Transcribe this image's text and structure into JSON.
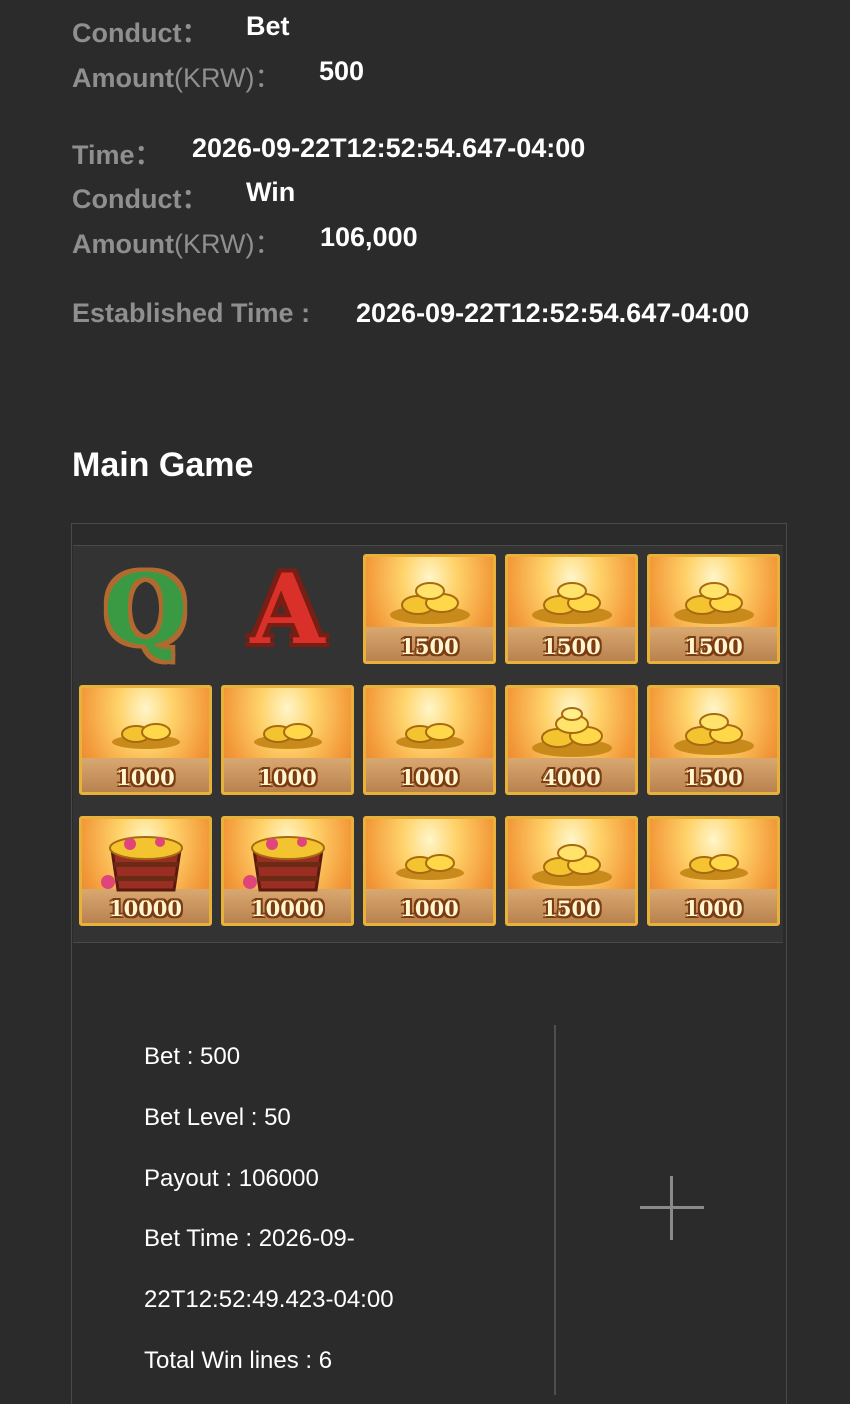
{
  "records": [
    {
      "conduct_label": "Conduct：",
      "conduct": "Bet",
      "amount_label": "Amount",
      "amount_unit": "(KRW)：",
      "amount": "500"
    },
    {
      "time_label": "Time：",
      "time": "2026-09-22T12:52:54.647-04:00",
      "conduct_label": "Conduct：",
      "conduct": "Win",
      "amount_label": "Amount",
      "amount_unit": "(KRW)：",
      "amount": "106,000"
    }
  ],
  "established": {
    "label": "Established Time :",
    "value": "2026-09-22T12:52:54.647-04:00"
  },
  "main_game": {
    "title": "Main Game",
    "reels": [
      [
        "Q",
        "A",
        "1500",
        "1500",
        "1500"
      ],
      [
        "1000",
        "1000",
        "1000",
        "4000",
        "1500"
      ],
      [
        "10000",
        "10000",
        "1000",
        "1500",
        "1000"
      ]
    ]
  },
  "summary": {
    "bet": "Bet : 500",
    "bet_level": "Bet Level : 50",
    "payout": "Payout : 106000",
    "bet_time_1": "Bet Time : 2026-09-",
    "bet_time_2": "22T12:52:49.423-04:00",
    "total_win_lines": "Total Win lines : 6"
  },
  "icons": {
    "expand": "plus-icon",
    "coins": "gold-coin-pile-icon",
    "barrel": "treasure-barrel-icon"
  }
}
